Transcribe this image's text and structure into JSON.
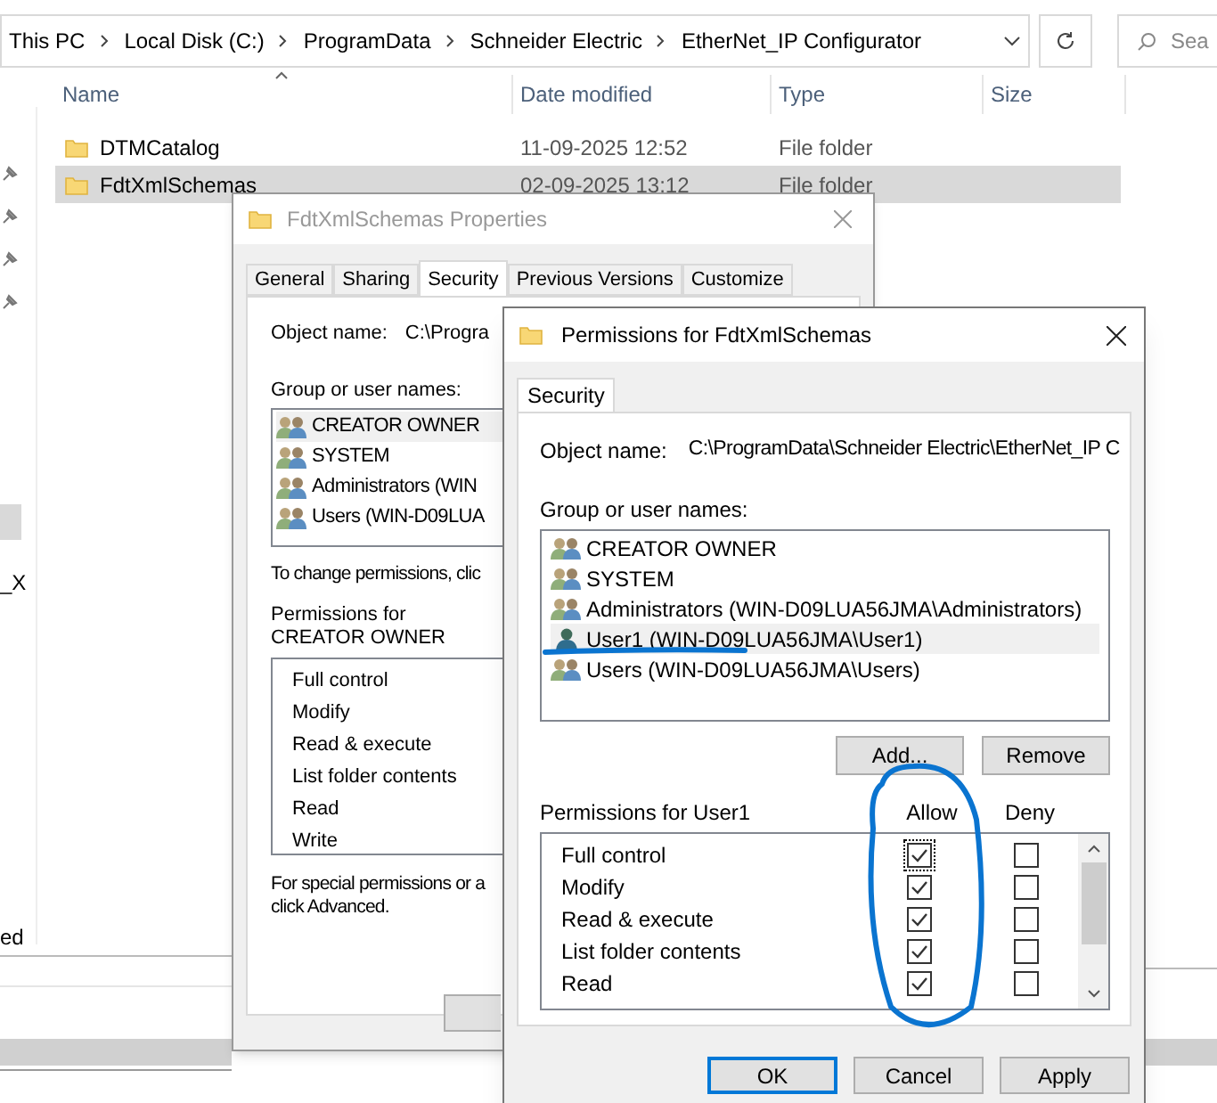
{
  "explorer": {
    "breadcrumb": [
      "This PC",
      "Local Disk (C:)",
      "ProgramData",
      "Schneider Electric",
      "EtherNet_IP Configurator"
    ],
    "search": {
      "placeholder": "Sea"
    },
    "columns": [
      "Name",
      "Date modified",
      "Type",
      "Size"
    ],
    "rows": [
      {
        "name": "DTMCatalog",
        "date": "11-09-2025 12:52",
        "type": "File folder",
        "selected": false
      },
      {
        "name": "FdtXmlSchemas",
        "date": "02-09-2025 13:12",
        "type": "File folder",
        "selected": true
      }
    ],
    "nav_fragments": [
      "_X",
      "ed"
    ]
  },
  "properties": {
    "title": "FdtXmlSchemas Properties",
    "tabs": [
      {
        "label": "General",
        "selected": false
      },
      {
        "label": "Sharing",
        "selected": false
      },
      {
        "label": "Security",
        "selected": true
      },
      {
        "label": "Previous Versions",
        "selected": false
      },
      {
        "label": "Customize",
        "selected": false
      }
    ],
    "object_name_label": "Object name:",
    "object_name_value": "C:\\Progra",
    "group_label": "Group or user names:",
    "groups": [
      {
        "name": "CREATOR OWNER",
        "selected": true
      },
      {
        "name": "SYSTEM",
        "selected": false
      },
      {
        "name": "Administrators (WIN",
        "selected": false
      },
      {
        "name": "Users (WIN-D09LUA",
        "selected": false
      }
    ],
    "change_hint": "To change permissions, clic",
    "permissions_label": "Permissions for CREATOR OWNER",
    "permissions": [
      "Full control",
      "Modify",
      "Read & execute",
      "List folder contents",
      "Read",
      "Write"
    ],
    "special_hint_lines": [
      "For special permissions or a",
      "click Advanced."
    ]
  },
  "permissions_dialog": {
    "title": "Permissions for FdtXmlSchemas",
    "tabs": [
      {
        "label": "Security",
        "selected": true
      }
    ],
    "object_name_label": "Object name:",
    "object_name_value": "C:\\ProgramData\\Schneider Electric\\EtherNet_IP C",
    "group_label": "Group or user names:",
    "groups": [
      {
        "name": "CREATOR OWNER",
        "kind": "group",
        "selected": false
      },
      {
        "name": "SYSTEM",
        "kind": "group",
        "selected": false
      },
      {
        "name": "Administrators (WIN-D09LUA56JMA\\Administrators)",
        "kind": "group",
        "selected": false
      },
      {
        "name": "User1 (WIN-D09LUA56JMA\\User1)",
        "kind": "user",
        "selected": true
      },
      {
        "name": "Users (WIN-D09LUA56JMA\\Users)",
        "kind": "group",
        "selected": false
      }
    ],
    "list_buttons": [
      "Add...",
      "Remove"
    ],
    "permissions_label": "Permissions for User1",
    "allow_header": "Allow",
    "deny_header": "Deny",
    "permissions": [
      {
        "name": "Full control",
        "allow": true,
        "deny": false
      },
      {
        "name": "Modify",
        "allow": true,
        "deny": false
      },
      {
        "name": "Read & execute",
        "allow": true,
        "deny": false
      },
      {
        "name": "List folder contents",
        "allow": true,
        "deny": false
      },
      {
        "name": "Read",
        "allow": true,
        "deny": false
      }
    ],
    "buttons": [
      {
        "label": "OK",
        "default": true
      },
      {
        "label": "Cancel",
        "default": false
      },
      {
        "label": "Apply",
        "default": false
      }
    ]
  }
}
